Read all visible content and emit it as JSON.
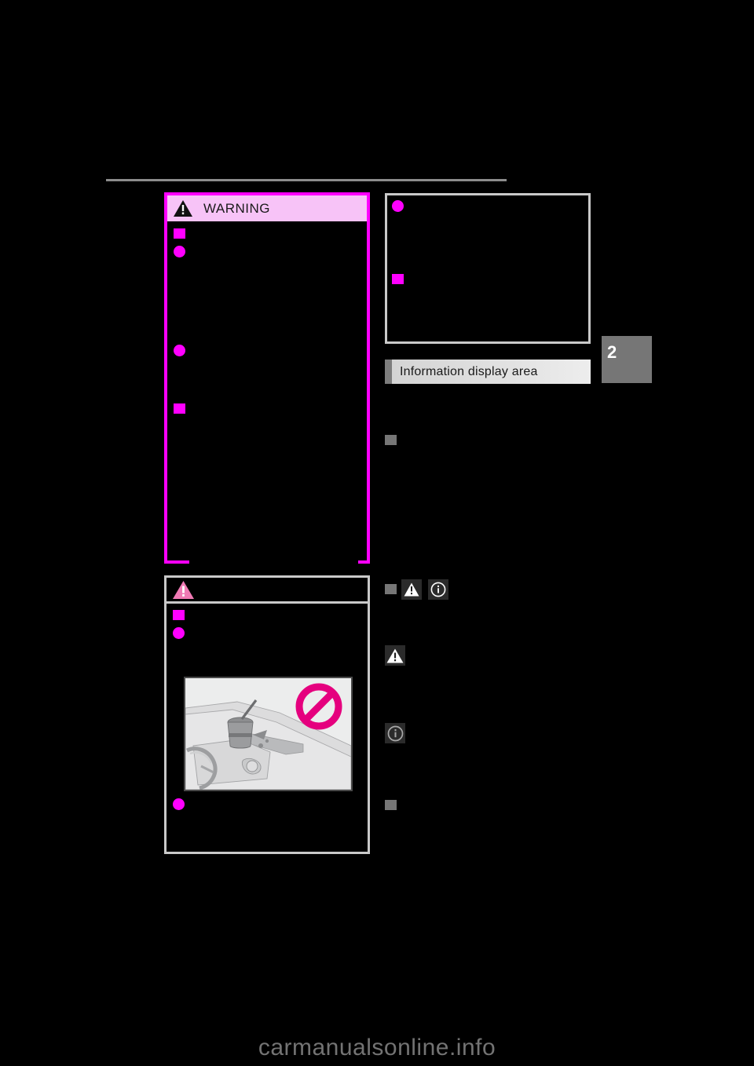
{
  "page": {
    "background_color": "#000000",
    "chapter_tab": {
      "number": "2",
      "color": "#767676"
    },
    "footer_watermark": "carmanualsonline.info"
  },
  "left_column": {
    "warning_box": {
      "title": "WARNING",
      "icon": "warning-triangle-icon",
      "header_color": "#F7C3F7",
      "border_color": "#FF00FF",
      "bullets": [
        {
          "type": "square",
          "marker_color": "#FF00FF"
        },
        {
          "type": "round",
          "marker_color": "#FF00FF"
        },
        {
          "type": "round",
          "marker_color": "#FF00FF"
        },
        {
          "type": "square",
          "marker_color": "#FF00FF"
        }
      ],
      "body_text": ""
    },
    "notice_box": {
      "title": "",
      "icon": "caution-triangle-icon",
      "border_color": "#C9C9C9",
      "bullets": [
        {
          "type": "square",
          "marker_color": "#FF00FF"
        },
        {
          "type": "round",
          "marker_color": "#FF00FF"
        },
        {
          "type": "round",
          "marker_color": "#FF00FF"
        }
      ],
      "illustration": {
        "name": "dashboard-drink-spill-illustration",
        "prohibition_symbol": true,
        "prohibition_color": "#E5007E",
        "background_color": "#ECECED"
      }
    }
  },
  "right_column": {
    "top_box": {
      "border_color": "#C9C9C9",
      "bullets": [
        {
          "type": "round",
          "marker_color": "#FF00FF"
        },
        {
          "type": "square",
          "marker_color": "#FF00FF"
        }
      ]
    },
    "section_header": {
      "title": "Information display area",
      "accent_color": "#7D7D7D"
    },
    "subsections": [
      {
        "marker": "square",
        "marker_color": "#767676",
        "label": ""
      },
      {
        "marker": "square",
        "marker_color": "#767676",
        "label": ""
      },
      {
        "marker": "square",
        "marker_color": "#767676",
        "label": ""
      }
    ],
    "icon_legend": [
      {
        "icon": "warning-triangle-icon",
        "chip_color": "#2B2B2B",
        "label": ""
      },
      {
        "icon": "info-circle-icon",
        "chip_color": "#2B2B2B",
        "label": ""
      }
    ]
  }
}
